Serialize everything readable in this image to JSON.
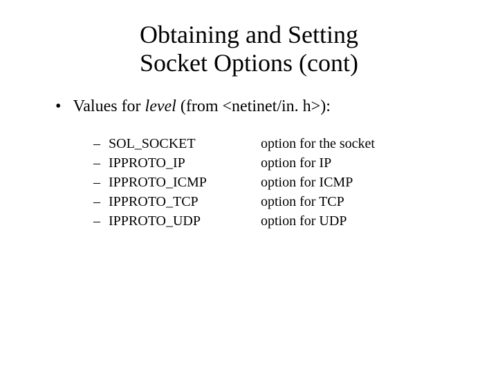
{
  "title_line1": "Obtaining and Setting",
  "title_line2": "Socket Options (cont)",
  "main_bullet_prefix": "Values for ",
  "main_bullet_level": "level",
  "main_bullet_suffix": " (from <netinet/in. h>):",
  "items": [
    {
      "label": "SOL_SOCKET",
      "desc": "option for the socket"
    },
    {
      "label": "IPPROTO_IP",
      "desc": "option for IP"
    },
    {
      "label": "IPPROTO_ICMP",
      "desc": "option for ICMP"
    },
    {
      "label": "IPPROTO_TCP",
      "desc": "option for TCP"
    },
    {
      "label": "IPPROTO_UDP",
      "desc": "option for UDP"
    }
  ],
  "bullet_dot": "•",
  "dash": "–"
}
